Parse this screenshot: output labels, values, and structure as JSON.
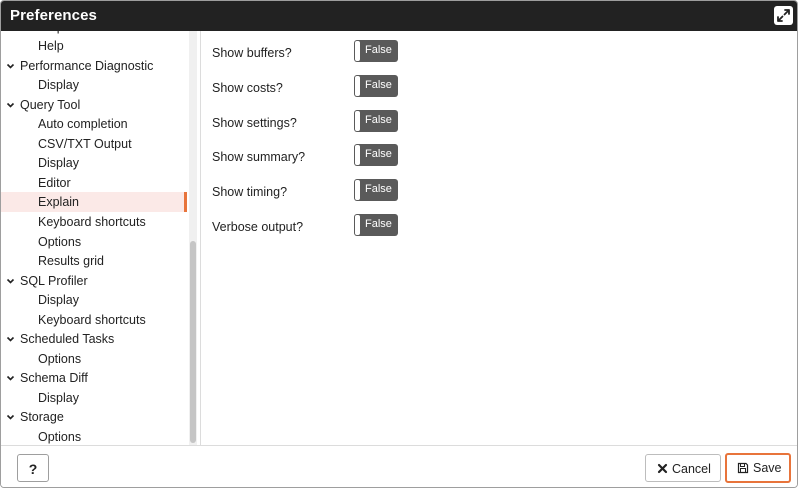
{
  "window": {
    "title": "Preferences"
  },
  "sidebar": {
    "items": [
      {
        "label": "Help",
        "level": "child"
      },
      {
        "label": "Performance Diagnostic",
        "level": "parent"
      },
      {
        "label": "Display",
        "level": "child"
      },
      {
        "label": "Query Tool",
        "level": "parent"
      },
      {
        "label": "Auto completion",
        "level": "child"
      },
      {
        "label": "CSV/TXT Output",
        "level": "child"
      },
      {
        "label": "Display",
        "level": "child"
      },
      {
        "label": "Editor",
        "level": "child"
      },
      {
        "label": "Explain",
        "level": "child",
        "selected": true
      },
      {
        "label": "Keyboard shortcuts",
        "level": "child"
      },
      {
        "label": "Options",
        "level": "child"
      },
      {
        "label": "Results grid",
        "level": "child"
      },
      {
        "label": "SQL Profiler",
        "level": "parent"
      },
      {
        "label": "Display",
        "level": "child"
      },
      {
        "label": "Keyboard shortcuts",
        "level": "child"
      },
      {
        "label": "Scheduled Tasks",
        "level": "parent"
      },
      {
        "label": "Options",
        "level": "child"
      },
      {
        "label": "Schema Diff",
        "level": "parent"
      },
      {
        "label": "Display",
        "level": "child"
      },
      {
        "label": "Storage",
        "level": "parent"
      },
      {
        "label": "Options",
        "level": "child"
      }
    ]
  },
  "settings": [
    {
      "label": "Show buffers?",
      "value": "False"
    },
    {
      "label": "Show costs?",
      "value": "False"
    },
    {
      "label": "Show settings?",
      "value": "False"
    },
    {
      "label": "Show summary?",
      "value": "False"
    },
    {
      "label": "Show timing?",
      "value": "False"
    },
    {
      "label": "Verbose output?",
      "value": "False"
    }
  ],
  "footer": {
    "help_label": "?",
    "cancel_label": "Cancel",
    "save_label": "Save"
  },
  "colors": {
    "accent": "#e8743b",
    "titlebar": "#222222",
    "toggle_off": "#5a5a5a",
    "selected_bg": "#fbe9e7"
  }
}
